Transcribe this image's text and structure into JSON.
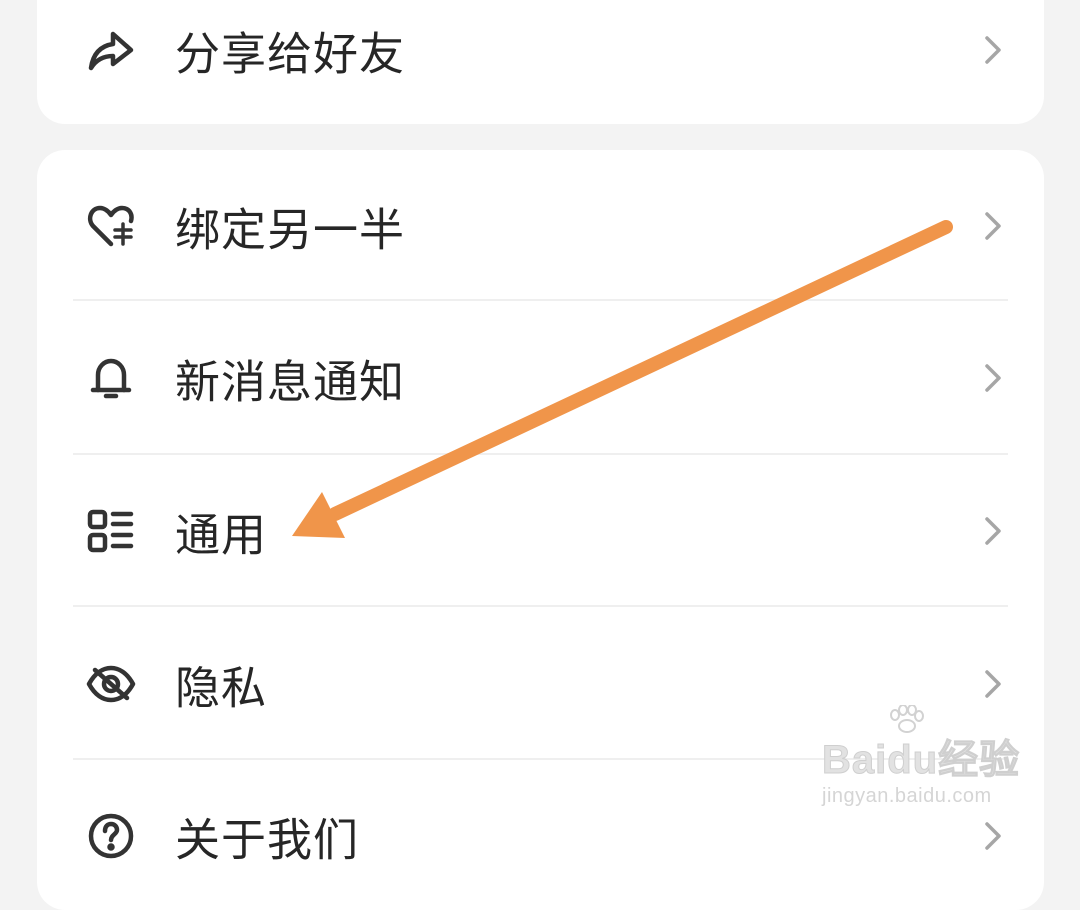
{
  "menu": {
    "share": {
      "label": "分享给好友",
      "icon": "share-icon"
    },
    "items": [
      {
        "label": "绑定另一半",
        "icon": "heart-link-icon"
      },
      {
        "label": "新消息通知",
        "icon": "bell-icon"
      },
      {
        "label": "通用",
        "icon": "grid-list-icon"
      },
      {
        "label": "隐私",
        "icon": "eye-off-icon"
      },
      {
        "label": "关于我们",
        "icon": "question-icon"
      }
    ]
  },
  "annotation": {
    "arrow_color": "#f0954a",
    "points_to": "通用"
  },
  "watermark": {
    "logo_text": "Baidu经验",
    "url": "jingyan.baidu.com"
  },
  "colors": {
    "background": "#f3f3f3",
    "card": "#ffffff",
    "text": "#262626",
    "icon": "#333333",
    "chevron": "#a6a6a6"
  }
}
